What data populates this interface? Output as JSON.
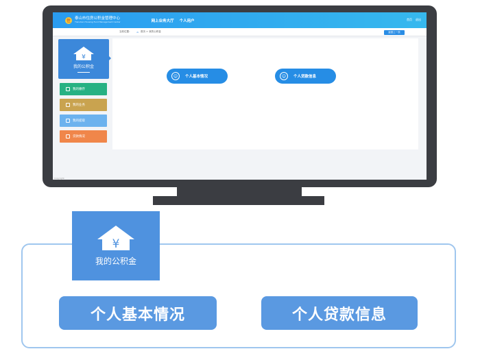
{
  "header": {
    "logo_glyph": "住",
    "org_name": "泰山市住房公积金管理中心",
    "org_name_en": "Tianshan Housing Fund Management Center",
    "nav": [
      "网上业务大厅",
      "个人用户"
    ],
    "right": [
      "首页",
      "退出"
    ]
  },
  "breadcrumb": {
    "label": "当前位置：",
    "path": "首页 > 我的公积金",
    "back_button": "返回上一页"
  },
  "sidebar": {
    "title": "我的公积金",
    "items": [
      {
        "label": "我的缴存",
        "color": "#27b183"
      },
      {
        "label": "我的业务",
        "color": "#c9a34f"
      },
      {
        "label": "我的提取",
        "color": "#6cb2ee"
      },
      {
        "label": "贷款情况",
        "color": "#f0864a"
      }
    ]
  },
  "content": {
    "buttons": [
      "个人基本情况",
      "个人贷款信息"
    ]
  },
  "footer_text": "Copyright",
  "callout": {
    "card_title": "我的公积金",
    "buttons": [
      "个人基本情况",
      "个人贷款信息"
    ]
  },
  "colors": {
    "monitor": "#3b3d42",
    "header_start": "#2a9cf0",
    "primary_button": "#268de5",
    "callout_button": "#5a99e1",
    "callout_card": "#4f92df",
    "callout_border": "#9fc6ee"
  },
  "icons": {
    "house": "house-yuan-icon",
    "person": "person-icon",
    "home": "home-icon"
  }
}
